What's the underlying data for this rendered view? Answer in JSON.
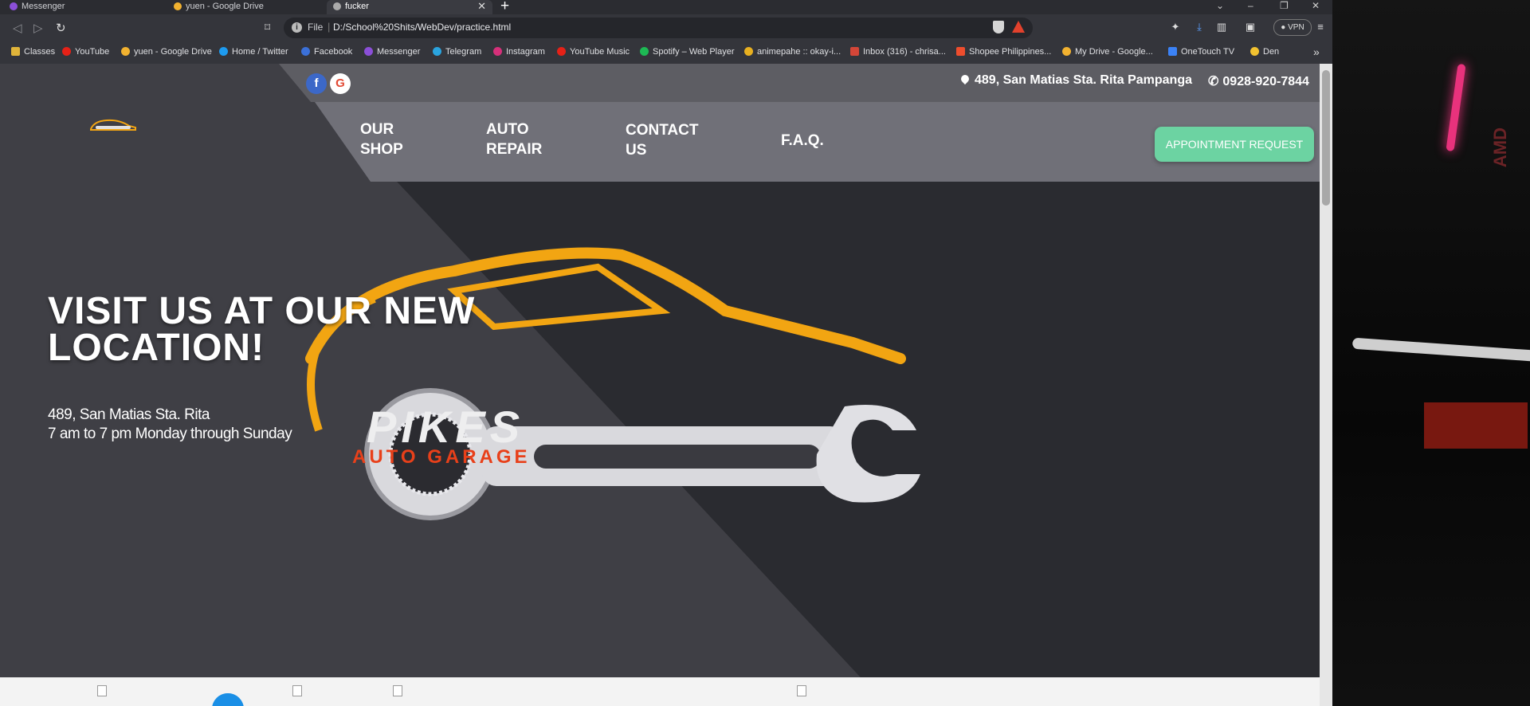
{
  "browser": {
    "tabs": [
      {
        "label": "Messenger",
        "color": "#8b4fd8"
      },
      {
        "label": "yuen - Google Drive",
        "color": "#f2b230"
      },
      {
        "label": "fucker",
        "color": "#aaaaaa"
      }
    ],
    "address": {
      "scheme_label": "File",
      "url": "D:/School%20Shits/WebDev/practice.html"
    },
    "vpn_label": "VPN",
    "bookmarks": [
      {
        "label": "Classes",
        "color": "#e0b43a"
      },
      {
        "label": "YouTube",
        "color": "#e62117"
      },
      {
        "label": "yuen - Google Drive",
        "color": "#f2b230"
      },
      {
        "label": "Home / Twitter",
        "color": "#1d9bf0"
      },
      {
        "label": "Facebook",
        "color": "#3b70d8"
      },
      {
        "label": "Messenger",
        "color": "#8b4fd8"
      },
      {
        "label": "Telegram",
        "color": "#2aa4df"
      },
      {
        "label": "Instagram",
        "color": "#d6307a"
      },
      {
        "label": "YouTube Music",
        "color": "#e62117"
      },
      {
        "label": "Spotify – Web Player",
        "color": "#1db954"
      },
      {
        "label": "animepahe :: okay-i...",
        "color": "#e8b020"
      },
      {
        "label": "Inbox (316) - chrisa...",
        "color": "#d44638"
      },
      {
        "label": "Shopee Philippines...",
        "color": "#ee4d2d"
      },
      {
        "label": "My Drive - Google...",
        "color": "#f2b230"
      },
      {
        "label": "OneTouch TV",
        "color": "#3b82f6"
      },
      {
        "label": "Den",
        "color": "#f2c230"
      }
    ]
  },
  "site": {
    "contact": {
      "address": "489, San Matias Sta. Rita Pampanga",
      "phone": "0928-920-7844"
    },
    "social": {
      "facebook_glyph": "f",
      "google_glyph": "G"
    },
    "nav": {
      "our_shop": [
        "OUR",
        "SHOP"
      ],
      "auto_repair": [
        "AUTO",
        "REPAIR"
      ],
      "contact_us": [
        "CONTACT",
        "US"
      ],
      "faq": "F.A.Q."
    },
    "cta": "APPOINTMENT REQUEST",
    "hero": {
      "title_line1": "VISIT US AT OUR NEW",
      "title_line2": "LOCATION!",
      "address": "489, San Matias Sta. Rita",
      "hours": "7 am to 7 pm Monday through Sunday"
    },
    "logo": {
      "brand": "PIKES",
      "tagline": "AUTO GARAGE"
    }
  },
  "colors": {
    "accent_green": "#6cd3a2",
    "logo_orange": "#f2a512",
    "logo_red": "#e8401a"
  }
}
